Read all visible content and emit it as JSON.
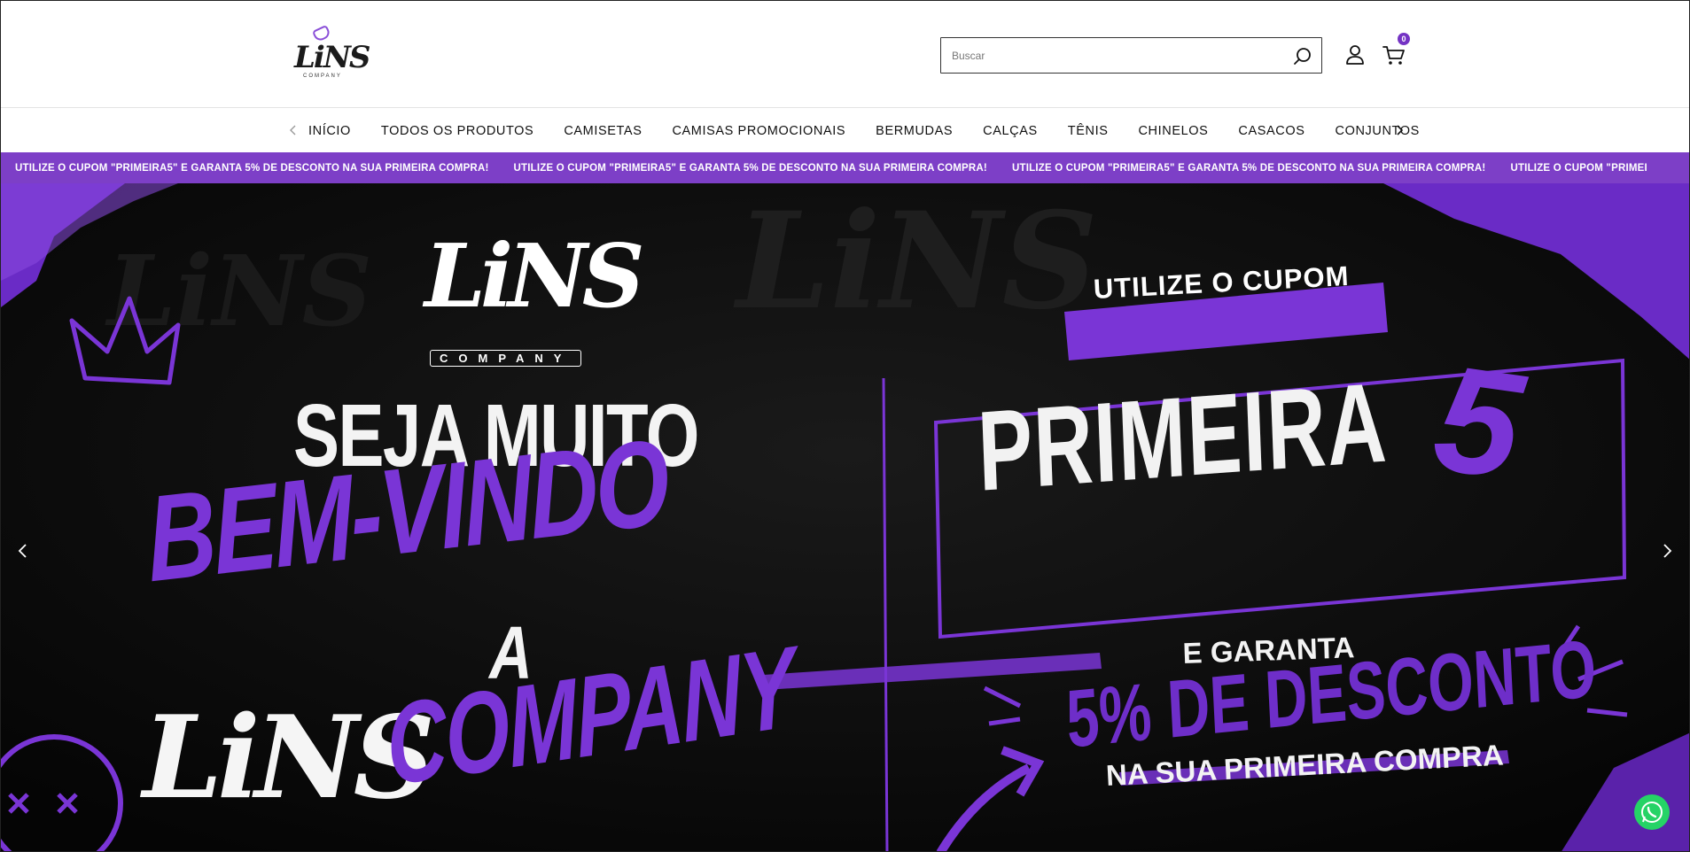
{
  "header": {
    "logo": {
      "text": "LiNS",
      "sub": "COMPANY"
    },
    "search": {
      "placeholder": "Buscar"
    },
    "icons": {
      "search": "search-icon",
      "user": "user-icon",
      "cart": "cart-icon"
    },
    "cart_count": "0"
  },
  "nav": {
    "items": [
      {
        "label": "INÍCIO"
      },
      {
        "label": "TODOS OS PRODUTOS"
      },
      {
        "label": "CAMISETAS"
      },
      {
        "label": "CAMISAS PROMOCIONAIS"
      },
      {
        "label": "BERMUDAS"
      },
      {
        "label": "CALÇAS"
      },
      {
        "label": "TÊNIS"
      },
      {
        "label": "CHINELOS"
      },
      {
        "label": "CASACOS"
      },
      {
        "label": "CONJUNTOS"
      }
    ],
    "icons": {
      "prev": "chevron-left-icon",
      "next": "chevron-right-icon"
    }
  },
  "promo": {
    "messages": [
      "UTILIZE O CUPOM \"PRIMEIRA5\" E GARANTA 5% DE DESCONTO NA SUA PRIMEIRA COMPRA!",
      "UTILIZE O CUPOM \"PRIMEIRA5\" E GARANTA 5% DE DESCONTO NA SUA PRIMEIRA COMPRA!",
      "UTILIZE O CUPOM \"PRIMEIRA5\" E GARANTA 5% DE DESCONTO NA SUA PRIMEIRA COMPRA!",
      "UTILIZE O CUPOM \"PRIMEI"
    ]
  },
  "hero": {
    "logo_text": "LiNS",
    "logo_sub": "COMPANY",
    "seja": "SEJA MUITO",
    "bem_vindo": "BEM-VINDO",
    "a": "A",
    "lins": "LiNS",
    "company": "COMPANY",
    "utilize": "UTILIZE O CUPOM",
    "primeira": "PRIMEIRA",
    "five": "5",
    "garanta": "E GARANTA",
    "desconto": "5% DE DESCONTO",
    "nasua": "NA SUA PRIMEIRA COMPRA",
    "icons": {
      "prev": "chevron-left-icon",
      "next": "chevron-right-icon",
      "crown": "crown-icon",
      "smiley": "smiley-icon",
      "arrow": "arrow-icon"
    }
  },
  "colors": {
    "brand_purple": "#7d3fc7",
    "accent": "#7a35d6",
    "whatsapp": "#25d366"
  },
  "widgets": {
    "whatsapp": "whatsapp-icon"
  }
}
